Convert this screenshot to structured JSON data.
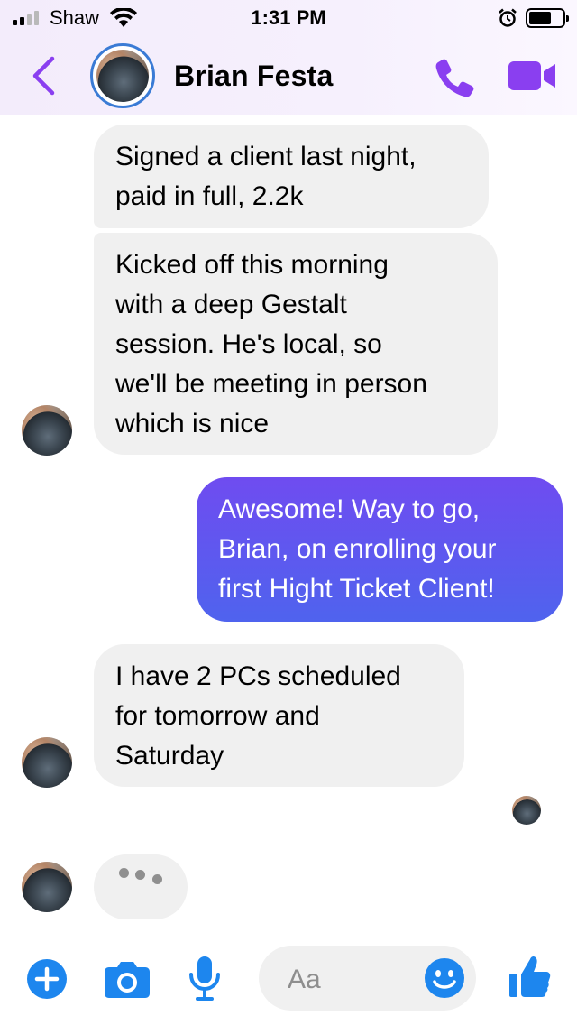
{
  "status": {
    "carrier": "Shaw",
    "time": "1:31 PM"
  },
  "header": {
    "contact_name": "Brian Festa",
    "icons": {
      "back": "chevron-left-icon",
      "call": "phone-icon",
      "video": "video-camera-icon"
    }
  },
  "messages": [
    {
      "from": "contact",
      "lines": [
        "Signed a client last night,",
        "paid in full, 2.2k"
      ]
    },
    {
      "from": "contact",
      "lines": [
        "Kicked off this morning",
        "with a deep Gestalt",
        "session. He's local, so",
        "we'll be meeting in person",
        "which is nice"
      ]
    },
    {
      "from": "me",
      "lines": [
        "Awesome! Way to go,",
        "Brian, on enrolling your",
        "first Hight Ticket Client!"
      ]
    },
    {
      "from": "contact",
      "lines": [
        "I have 2 PCs scheduled",
        "for tomorrow and",
        "Saturday"
      ]
    }
  ],
  "composer": {
    "placeholder": "Aa",
    "icons": [
      "plus-icon",
      "camera-icon",
      "microphone-icon",
      "emoji-icon",
      "thumbs-up-icon"
    ]
  },
  "colors": {
    "accent_purple": "#8a3ff0",
    "accent_blue": "#1d86ee",
    "sent_bubble_top": "#6f4cf0",
    "sent_bubble_bottom": "#4f63ee",
    "received_bubble": "#f0f0f0"
  }
}
